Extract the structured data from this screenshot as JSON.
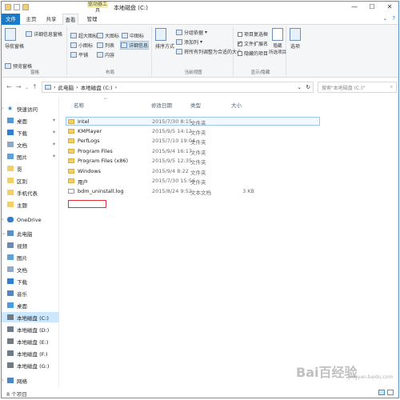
{
  "window": {
    "title": "本地磁盘 (C:)",
    "contextual_tab": "驱动器工具"
  },
  "ribbon_tabs": {
    "file": "文件",
    "home": "主页",
    "share": "共享",
    "view": "查看",
    "manage": "管理"
  },
  "ribbon": {
    "panes": {
      "nav_pane": "导航窗格",
      "preview_pane": "预览窗格",
      "details_pane": "详细信息窗格",
      "label": "窗格"
    },
    "layout": {
      "extra_large": "超大图标",
      "large": "大图标",
      "medium": "中图标",
      "small": "小图标",
      "list": "列表",
      "details": "详细信息",
      "tiles": "平铺",
      "content": "内容",
      "label": "布局"
    },
    "current_view": {
      "sort_by": "排序方式",
      "group_by": "分组依据",
      "add_columns": "添加列",
      "size_all": "将所有列调整为合适的大小",
      "label": "当前视图"
    },
    "show_hide": {
      "item_checkboxes": "项目复选框",
      "file_ext": "文件扩展名",
      "hidden_items": "隐藏的项目",
      "hide_selected": "隐藏\n所选项目",
      "label": "显示/隐藏"
    },
    "options": "选项"
  },
  "address": {
    "path": [
      "此电脑",
      "本地磁盘 (C:)"
    ],
    "search_placeholder": "搜索\"本地磁盘 (C:)\""
  },
  "sidebar": {
    "quick_access": "快速访问",
    "items": [
      {
        "label": "桌面",
        "icon": "desktop-icon",
        "pinned": true
      },
      {
        "label": "下载",
        "icon": "download-icon",
        "pinned": true
      },
      {
        "label": "文档",
        "icon": "documents-icon",
        "pinned": true
      },
      {
        "label": "图片",
        "icon": "pictures-icon",
        "pinned": true
      },
      {
        "label": "哥",
        "icon": "folder-icon",
        "pinned": false
      },
      {
        "label": "区别",
        "icon": "folder-icon",
        "pinned": false
      },
      {
        "label": "手机代表",
        "icon": "folder-icon",
        "pinned": false
      },
      {
        "label": "主题",
        "icon": "folder-icon",
        "pinned": false
      }
    ],
    "onedrive": "OneDrive",
    "this_pc": "此电脑",
    "pc_items": [
      {
        "label": "视频",
        "icon": "videos-icon"
      },
      {
        "label": "图片",
        "icon": "pictures-icon"
      },
      {
        "label": "文档",
        "icon": "documents-icon"
      },
      {
        "label": "下载",
        "icon": "download-icon"
      },
      {
        "label": "音乐",
        "icon": "music-icon"
      },
      {
        "label": "桌面",
        "icon": "desktop-icon"
      },
      {
        "label": "本地磁盘 (C:)",
        "icon": "drive-icon",
        "selected": true
      },
      {
        "label": "本地磁盘 (D:)",
        "icon": "drive-icon"
      },
      {
        "label": "本地磁盘 (E:)",
        "icon": "drive-icon"
      },
      {
        "label": "本地磁盘 (F:)",
        "icon": "drive-icon"
      },
      {
        "label": "本地磁盘 (G:)",
        "icon": "drive-icon"
      }
    ],
    "network": "网络"
  },
  "columns": {
    "name": "名称",
    "date": "修改日期",
    "type": "类型",
    "size": "大小"
  },
  "files": [
    {
      "name": "Intel",
      "date": "2015/7/30 8:15",
      "type": "文件夹",
      "size": "",
      "kind": "folder"
    },
    {
      "name": "KMPlayer",
      "date": "2015/9/5 14:12",
      "type": "文件夹",
      "size": "",
      "kind": "folder"
    },
    {
      "name": "PerfLogs",
      "date": "2015/7/10 19:04",
      "type": "文件夹",
      "size": "",
      "kind": "folder"
    },
    {
      "name": "Program Files",
      "date": "2015/9/4 16:17",
      "type": "文件夹",
      "size": "",
      "kind": "folder"
    },
    {
      "name": "Program Files (x86)",
      "date": "2015/9/5 12:35",
      "type": "文件夹",
      "size": "",
      "kind": "folder"
    },
    {
      "name": "Windows",
      "date": "2015/9/4 8:22",
      "type": "文件夹",
      "size": "",
      "kind": "folder"
    },
    {
      "name": "用户",
      "date": "2015/7/30 15:56",
      "type": "文件夹",
      "size": "",
      "kind": "folder"
    },
    {
      "name": "bdm_uninstall.log",
      "date": "2015/8/24 9:52",
      "type": "文本文档",
      "size": "3 KB",
      "kind": "file"
    }
  ],
  "status": {
    "count": "8 个项目"
  },
  "watermark": {
    "main": "Bai百经验",
    "sub": "jingyan.baidu.com"
  },
  "colors": {
    "accent": "#1979ca",
    "highlight_box": "#e0303a",
    "selection": "#cce8ff"
  }
}
